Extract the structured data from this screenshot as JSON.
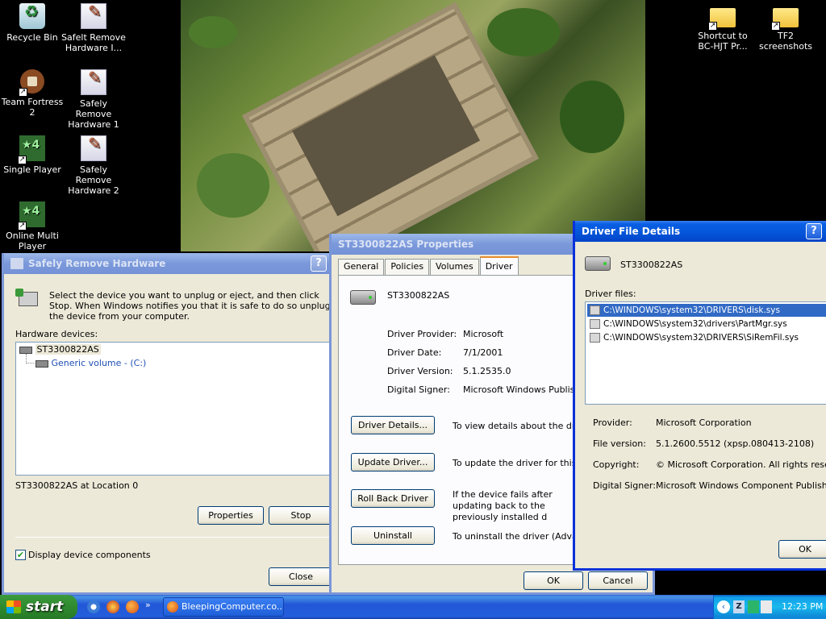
{
  "desktop": {
    "icons": [
      {
        "label": "Recycle Bin",
        "icon": "recycle-bin-icon"
      },
      {
        "label": "Safelt Remove Hardware I...",
        "icon": "safely-remove-hardware-icon"
      },
      {
        "label": "Team Fortress 2",
        "icon": "team-fortress-2-icon"
      },
      {
        "label": "Safely Remove Hardware 1",
        "icon": "safely-remove-hardware-icon"
      },
      {
        "label": "Single Player",
        "icon": "game-icon"
      },
      {
        "label": "Safely Remove Hardware 2",
        "icon": "safely-remove-hardware-icon"
      },
      {
        "label": "Online Multi Player",
        "icon": "game-icon"
      },
      {
        "label": "Shortcut to BC-HJT Pr...",
        "icon": "folder-icon"
      },
      {
        "label": "TF2 screenshots",
        "icon": "folder-icon"
      }
    ]
  },
  "safely_remove": {
    "title": "Safely Remove Hardware",
    "instructions": "Select the device you want to unplug or eject, and then click Stop. When Windows notifies you that it is safe to do so unplug the device from your computer.",
    "hardware_label": "Hardware devices:",
    "devices": [
      {
        "name": "ST3300822AS"
      },
      {
        "name": "Generic volume - (C:)"
      }
    ],
    "location": "ST3300822AS at Location 0",
    "properties_btn": "Properties",
    "stop_btn": "Stop",
    "display_components": "Display device components",
    "close_btn": "Close"
  },
  "properties": {
    "title": "ST3300822AS Properties",
    "tabs": [
      "General",
      "Policies",
      "Volumes",
      "Driver"
    ],
    "active_tab": "Driver",
    "device_name": "ST3300822AS",
    "fields": [
      {
        "label": "Driver Provider:",
        "value": "Microsoft"
      },
      {
        "label": "Driver Date:",
        "value": "7/1/2001"
      },
      {
        "label": "Driver Version:",
        "value": "5.1.2535.0"
      },
      {
        "label": "Digital Signer:",
        "value": "Microsoft Windows Publisher"
      }
    ],
    "actions": [
      {
        "button": "Driver Details...",
        "desc": "To view details about the driver"
      },
      {
        "button": "Update Driver...",
        "desc": "To update the driver for this dev"
      },
      {
        "button": "Roll Back Driver",
        "desc": "If the device fails after updating back to the previously installed d"
      },
      {
        "button": "Uninstall",
        "desc": "To uninstall the driver (Advanced"
      }
    ],
    "ok_btn": "OK",
    "cancel_btn": "Cancel"
  },
  "driver_details": {
    "title": "Driver File Details",
    "device_name": "ST3300822AS",
    "files_label": "Driver files:",
    "files": [
      "C:\\WINDOWS\\system32\\DRIVERS\\disk.sys",
      "C:\\WINDOWS\\system32\\drivers\\PartMgr.sys",
      "C:\\WINDOWS\\system32\\DRIVERS\\SiRemFil.sys"
    ],
    "info": [
      {
        "label": "Provider:",
        "value": "Microsoft Corporation"
      },
      {
        "label": "File version:",
        "value": "5.1.2600.5512 (xpsp.080413-2108)"
      },
      {
        "label": "Copyright:",
        "value": "© Microsoft Corporation. All rights reserved."
      },
      {
        "label": "Digital Signer:",
        "value": "Microsoft Windows Component Publisher"
      }
    ],
    "ok_btn": "OK"
  },
  "taskbar": {
    "start": "start",
    "task": "BleepingComputer.co...",
    "clock": "12:23 PM"
  }
}
